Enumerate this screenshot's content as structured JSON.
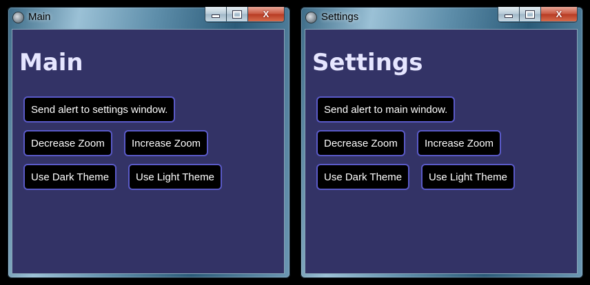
{
  "windows": [
    {
      "title": "Main",
      "heading": "Main",
      "alert_button": "Send alert to settings window.",
      "decrease_zoom": "Decrease Zoom",
      "increase_zoom": "Increase Zoom",
      "dark_theme": "Use Dark Theme",
      "light_theme": "Use Light Theme"
    },
    {
      "title": "Settings",
      "heading": "Settings",
      "alert_button": "Send alert to main window.",
      "decrease_zoom": "Decrease Zoom",
      "increase_zoom": "Increase Zoom",
      "dark_theme": "Use Dark Theme",
      "light_theme": "Use Light Theme"
    }
  ],
  "controls": {
    "close_glyph": "X"
  },
  "colors": {
    "client_bg": "#333366",
    "heading": "#e6e6ff",
    "button_bg": "#000000",
    "button_border": "#5a5ac8",
    "button_text": "#ffffff"
  },
  "icons": [
    "app-icon",
    "minimize-icon",
    "maximize-icon",
    "close-icon"
  ]
}
